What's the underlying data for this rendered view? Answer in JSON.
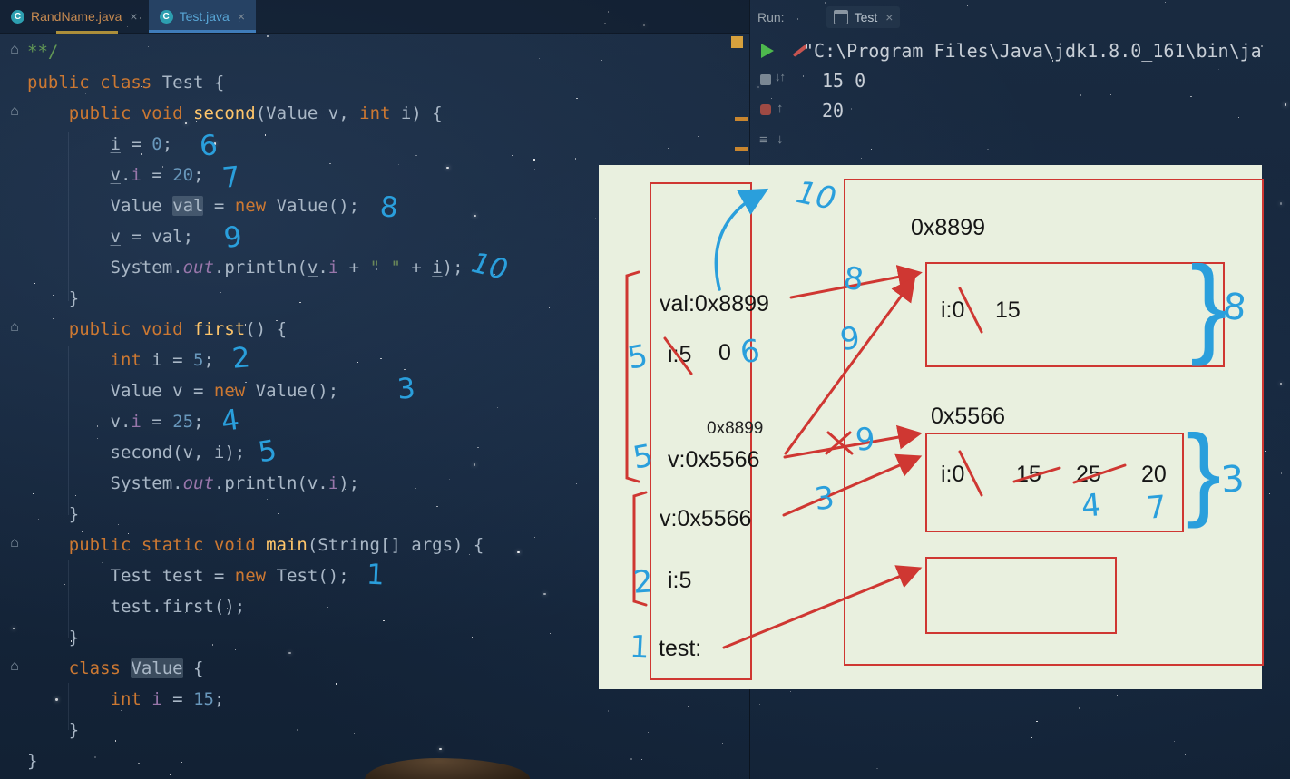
{
  "tabs": {
    "editor": [
      {
        "label": "RandName.java"
      },
      {
        "label": "Test.java"
      }
    ]
  },
  "run": {
    "label": "Run:",
    "tab": "Test"
  },
  "icons": {
    "close": "×",
    "fold": "⌂",
    "sort": "↓↑",
    "up": "↑",
    "down": "↓",
    "menu": "≡",
    "class_letter": "C",
    "brace": "}"
  },
  "code": {
    "lines": [
      [
        [
          "c",
          "**/"
        ]
      ],
      [
        [
          "k",
          "public class "
        ],
        [
          "p",
          "Test {"
        ]
      ],
      [
        [
          "p",
          "    "
        ],
        [
          "k",
          "public void "
        ],
        [
          "f",
          "second"
        ],
        [
          "p",
          "("
        ],
        [
          "p",
          "Value "
        ],
        [
          "u",
          "v"
        ],
        [
          "p",
          ", "
        ],
        [
          "k",
          "int "
        ],
        [
          "u",
          "i"
        ],
        [
          "p",
          ") {"
        ]
      ],
      [
        [
          "p",
          "        "
        ],
        [
          "u",
          "i"
        ],
        [
          "p",
          " = "
        ],
        [
          "n",
          "0"
        ],
        [
          "p",
          ";"
        ]
      ],
      [
        [
          "p",
          "        "
        ],
        [
          "u",
          "v"
        ],
        [
          "p",
          "."
        ],
        [
          "i",
          "i"
        ],
        [
          "p",
          " = "
        ],
        [
          "n",
          "20"
        ],
        [
          "p",
          ";"
        ]
      ],
      [
        [
          "p",
          "        "
        ],
        [
          "p",
          "Value "
        ],
        [
          "h",
          "val"
        ],
        [
          "p",
          " = "
        ],
        [
          "k",
          "new "
        ],
        [
          "p",
          "Value();"
        ]
      ],
      [
        [
          "p",
          "        "
        ],
        [
          "u",
          "v"
        ],
        [
          "p",
          " = val;"
        ]
      ],
      [
        [
          "p",
          "        "
        ],
        [
          "p",
          "System."
        ],
        [
          "o",
          "out"
        ],
        [
          "p",
          ".println("
        ],
        [
          "u",
          "v"
        ],
        [
          "p",
          "."
        ],
        [
          "i",
          "i"
        ],
        [
          "p",
          " + "
        ],
        [
          "s",
          "\" \""
        ],
        [
          "p",
          " + "
        ],
        [
          "u",
          "i"
        ],
        [
          "p",
          ");"
        ]
      ],
      [
        [
          "p",
          "    }"
        ]
      ],
      [
        [
          "p",
          "    "
        ],
        [
          "k",
          "public void "
        ],
        [
          "f",
          "first"
        ],
        [
          "p",
          "() {"
        ]
      ],
      [
        [
          "p",
          "        "
        ],
        [
          "k",
          "int "
        ],
        [
          "p",
          "i = "
        ],
        [
          "n",
          "5"
        ],
        [
          "p",
          ";"
        ]
      ],
      [
        [
          "p",
          "        "
        ],
        [
          "p",
          "Value v = "
        ],
        [
          "k",
          "new "
        ],
        [
          "p",
          "Value();"
        ]
      ],
      [
        [
          "p",
          "        "
        ],
        [
          "p",
          "v."
        ],
        [
          "i",
          "i"
        ],
        [
          "p",
          " = "
        ],
        [
          "n",
          "25"
        ],
        [
          "p",
          ";"
        ]
      ],
      [
        [
          "p",
          "        "
        ],
        [
          "p",
          "second(v, i);"
        ]
      ],
      [
        [
          "p",
          "        "
        ],
        [
          "p",
          "System."
        ],
        [
          "o",
          "out"
        ],
        [
          "p",
          ".println(v."
        ],
        [
          "i",
          "i"
        ],
        [
          "p",
          ");"
        ]
      ],
      [
        [
          "p",
          "    }"
        ]
      ],
      [
        [
          "p",
          "    "
        ],
        [
          "k",
          "public static void "
        ],
        [
          "f",
          "main"
        ],
        [
          "p",
          "(String[] args) {"
        ]
      ],
      [
        [
          "p",
          "        "
        ],
        [
          "p",
          "Test test = "
        ],
        [
          "k",
          "new "
        ],
        [
          "p",
          "Test();"
        ]
      ],
      [
        [
          "p",
          "        "
        ],
        [
          "p",
          "test.first();"
        ]
      ],
      [
        [
          "p",
          "    }"
        ]
      ],
      [
        [
          "p",
          "    "
        ],
        [
          "k",
          "class "
        ],
        [
          "h",
          "Value"
        ],
        [
          "p",
          " {"
        ]
      ],
      [
        [
          "p",
          "        "
        ],
        [
          "k",
          "int "
        ],
        [
          "i",
          "i"
        ],
        [
          "p",
          " = "
        ],
        [
          "n",
          "15"
        ],
        [
          "p",
          ";"
        ]
      ],
      [
        [
          "p",
          "    }"
        ]
      ],
      [
        [
          "p",
          "}"
        ]
      ]
    ]
  },
  "console": {
    "lines": [
      "\"C:\\Program Files\\Java\\jdk1.8.0_161\\bin\\ja",
      "15 0",
      "20"
    ]
  },
  "annotations": {
    "code": [
      "6",
      "7",
      "8",
      "9",
      "10",
      "2",
      "3",
      "4",
      "5",
      "1"
    ],
    "diagram": [
      "10",
      "8",
      "9",
      "9",
      "6",
      "5",
      "5",
      "2",
      "3",
      "1",
      "4",
      "7",
      "8",
      "3"
    ]
  },
  "diagram": {
    "stack": {
      "val_entry": "val:0x8899",
      "i_entry": "i:5",
      "i_new_value": "0",
      "addr_note": "0x8899",
      "v_entry": "v:0x5566",
      "v2_entry": "v:0x5566",
      "i2_entry": "i:5",
      "test_entry": "test:"
    },
    "heap": {
      "box_a_label": "0x8899",
      "box_a_field": "i:0",
      "box_a_value": "15",
      "box_b_label": "0x5566",
      "box_b_field": "i:0",
      "box_b_v1": "15",
      "box_b_v2": "25",
      "box_b_v3": "20"
    }
  },
  "colors": {
    "annotation_blue": "#2a9fdc",
    "marker_red": "#cf3732",
    "diagram_bg": "#e9f0df",
    "keyword_orange": "#cc7832",
    "number_blue": "#6897bb",
    "string_green": "#6a8759",
    "method_yellow": "#ffc66b"
  }
}
